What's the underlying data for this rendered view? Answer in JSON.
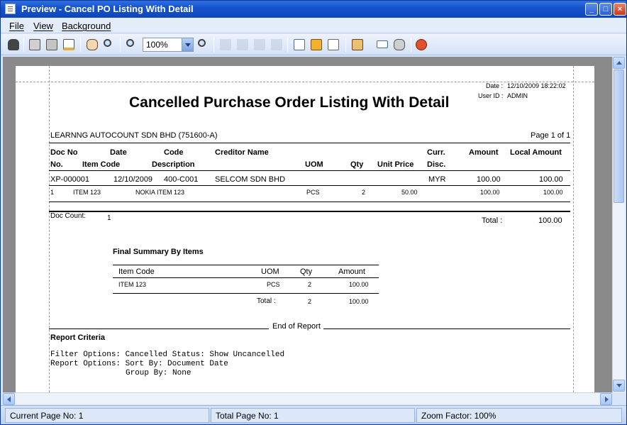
{
  "window": {
    "title": "Preview - Cancel PO Listing With Detail",
    "minimize": "_",
    "maximize": "□",
    "close": "×"
  },
  "menu": {
    "file": "File",
    "view": "View",
    "background": "Background"
  },
  "toolbar": {
    "zoom_value": "100%",
    "icons": [
      "binoculars-icon",
      "printer-setup-icon",
      "printer-icon",
      "page-setup-icon",
      "hand-icon",
      "magnifier-icon",
      "zoom-out-icon",
      "zoom-in-icon",
      "first-page-icon",
      "previous-page-icon",
      "next-page-icon",
      "last-page-icon",
      "multi-page-icon",
      "color-icon",
      "watermark-icon",
      "export-icon",
      "email-icon",
      "send-icon",
      "exit-icon"
    ]
  },
  "report": {
    "date_label": "Date :",
    "date_value": "12/10/2009 18:22:02",
    "user_label": "User ID :",
    "user_value": "ADMIN",
    "title": "Cancelled Purchase Order Listing With Detail",
    "company": "LEARNNG AUTOCOUNT SDN BHD (751600-A)",
    "page_info": "Page 1 of 1",
    "headers_row1": {
      "doc_no": "Doc No",
      "date": "Date",
      "code": "Code",
      "creditor": "Creditor Name",
      "curr": "Curr.",
      "amount": "Amount",
      "local_amount": "Local Amount"
    },
    "headers_row2": {
      "no": "No.",
      "item_code": "Item Code",
      "description": "Description",
      "uom": "UOM",
      "qty": "Qty",
      "unit_price": "Unit Price",
      "disc": "Disc."
    },
    "doc": {
      "doc_no": "XP-000001",
      "date": "12/10/2009",
      "code": "400-C001",
      "creditor": "SELCOM SDN BHD",
      "curr": "MYR",
      "amount": "100.00",
      "local_amount": "100.00"
    },
    "detail": {
      "no": "1",
      "item_code": "ITEM 123",
      "description": "NOKIA ITEM 123",
      "uom": "PCS",
      "qty": "2",
      "unit_price": "50.00",
      "amount": "100.00",
      "local_amount": "100.00"
    },
    "doc_count_label": "Doc Count:",
    "doc_count_value": "1",
    "total_label": "Total :",
    "total_value": "100.00",
    "summary": {
      "title": "Final Summary By Items",
      "headers": {
        "item_code": "Item Code",
        "uom": "UOM",
        "qty": "Qty",
        "amount": "Amount"
      },
      "row": {
        "item_code": "ITEM 123",
        "uom": "PCS",
        "qty": "2",
        "amount": "100.00"
      },
      "total_label": "Total :",
      "total_qty": "2",
      "total_amount": "100.00"
    },
    "end_of_report": "End of Report",
    "criteria_title": "Report Criteria",
    "criteria_line1": "Filter Options: Cancelled Status: Show Uncancelled",
    "criteria_line2": "Report Options: Sort By: Document Date",
    "criteria_line3": "Group By: None"
  },
  "status": {
    "current_page": "Current Page No: 1",
    "total_page": "Total Page No: 1",
    "zoom_factor": "Zoom Factor: 100%"
  },
  "colors": {
    "titlebar": "#1553cf",
    "accent": "#0a3a9a"
  }
}
